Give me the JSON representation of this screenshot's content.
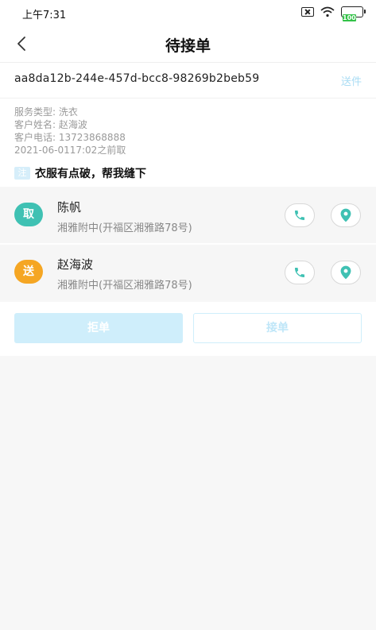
{
  "status_bar": {
    "time": "上午7:31",
    "battery_text": "100"
  },
  "header": {
    "title": "待接单"
  },
  "order": {
    "id": "aa8da12b-244e-457d-bcc8-98269b2beb59",
    "type_label": "送件",
    "service_type": "服务类型: 洗衣",
    "customer_name": "客户姓名: 赵海波",
    "customer_phone": "客户电话: 13723868888",
    "pickup_time": "2021-06-0117:02之前取",
    "note_tag": "注",
    "note_text": "衣服有点破，帮我缝下"
  },
  "contacts": [
    {
      "badge": "取",
      "badge_color": "#3fc1b3",
      "name": "陈帆",
      "address": "湘雅附中(开福区湘雅路78号)"
    },
    {
      "badge": "送",
      "badge_color": "#f5a623",
      "name": "赵海波",
      "address": "湘雅附中(开福区湘雅路78号)"
    }
  ],
  "actions": {
    "reject_label": "拒单",
    "accept_label": "接单"
  },
  "icons": {
    "back": "back-arrow-icon",
    "phone": "phone-icon",
    "location": "location-pin-icon",
    "accent_color": "#3fc1b3"
  }
}
